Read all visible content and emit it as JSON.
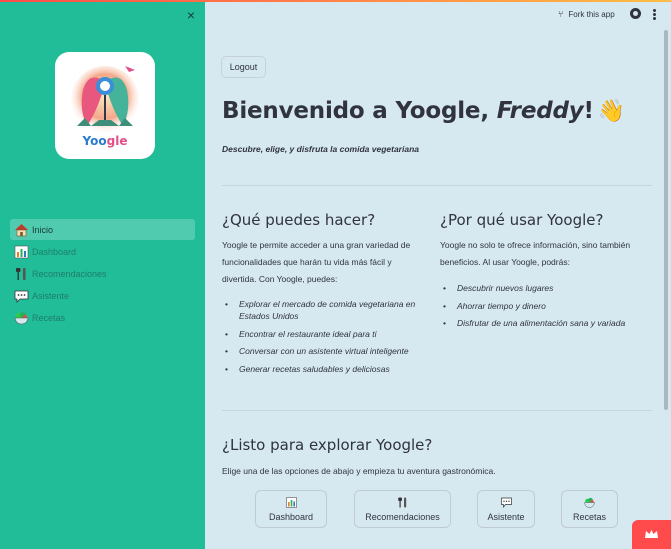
{
  "sidebar": {
    "close_glyph": "×",
    "logo_text_part1": "Yoo",
    "logo_text_part2": "gle",
    "nav": [
      {
        "label": "Inicio",
        "icon": "house-icon",
        "active": true
      },
      {
        "label": "Dashboard",
        "icon": "chart-icon",
        "active": false
      },
      {
        "label": "Recomendaciones",
        "icon": "utensils-icon",
        "active": false
      },
      {
        "label": "Asistente",
        "icon": "speech-bubble-icon",
        "active": false
      },
      {
        "label": "Recetas",
        "icon": "salad-bowl-icon",
        "active": false
      }
    ]
  },
  "header": {
    "fork_label": "Fork this app"
  },
  "main": {
    "logout_label": "Logout",
    "welcome_prefix": "Bienvenido a Yoogle, ",
    "welcome_name": "Freddy",
    "welcome_suffix": "!",
    "wave_emoji": "👋",
    "subtitle": "Descubre, elige, y disfruta la comida vegetariana",
    "left": {
      "heading": "¿Qué puedes hacer?",
      "intro": "Yoogle te permite acceder a una gran variedad de funcionalidades que harán tu vida más fácil y divertida. Con Yoogle, puedes:",
      "items": [
        "Explorar el mercado de comida vegetariana en Estados Unidos",
        "Encontrar el restaurante ideal para ti",
        "Conversar con un asistente virtual inteligente",
        "Generar recetas saludables y deliciosas"
      ]
    },
    "right": {
      "heading": "¿Por qué usar Yoogle?",
      "intro": "Yoogle no solo te ofrece información, sino también beneficios. Al usar Yoogle, podrás:",
      "items": [
        "Descubrir nuevos lugares",
        "Ahorrar tiempo y dinero",
        "Disfrutar de una alimentación sana y variada"
      ]
    },
    "cta_heading": "¿Listo para explorar Yoogle?",
    "cta_text": "Elige una de las opciones de abajo y empieza tu aventura gastronómica.",
    "buttons": [
      {
        "label": "Dashboard",
        "icon": "chart-icon"
      },
      {
        "label": "Recomendaciones",
        "icon": "utensils-icon"
      },
      {
        "label": "Asistente",
        "icon": "speech-bubble-icon"
      },
      {
        "label": "Recetas",
        "icon": "salad-bowl-icon"
      }
    ]
  },
  "colors": {
    "sidebar_bg": "#21bd99",
    "main_bg": "#d6e9f0",
    "accent": "#ff4b4b"
  }
}
